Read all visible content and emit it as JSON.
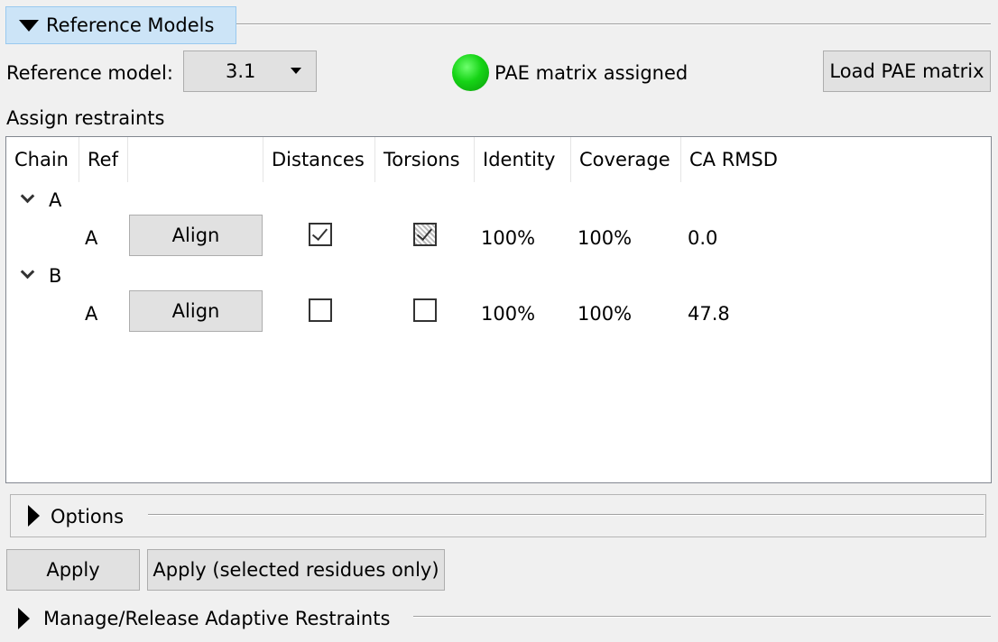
{
  "section": {
    "title": "Reference Models"
  },
  "reference": {
    "label": "Reference model:",
    "selected": "3.1",
    "status_text": "PAE matrix assigned",
    "load_button": "Load PAE matrix"
  },
  "assign_label": "Assign restraints",
  "table": {
    "columns": [
      "Chain",
      "Ref",
      "",
      "Distances",
      "Torsions",
      "Identity",
      "Coverage",
      "CA RMSD"
    ],
    "groups": [
      {
        "chain": "A",
        "rows": [
          {
            "ref": "A",
            "action": "Align",
            "distances": true,
            "torsions": true,
            "identity": "100%",
            "coverage": "100%",
            "rmsd": "0.0"
          }
        ]
      },
      {
        "chain": "B",
        "rows": [
          {
            "ref": "A",
            "action": "Align",
            "distances": false,
            "torsions": false,
            "identity": "100%",
            "coverage": "100%",
            "rmsd": "47.8"
          }
        ]
      }
    ]
  },
  "options": {
    "title": "Options"
  },
  "buttons": {
    "apply": "Apply",
    "apply_selected": "Apply (selected residues only)"
  },
  "manage": {
    "title": "Manage/Release Adaptive Restraints"
  },
  "colors": {
    "status_green": "#16d416",
    "header_bg": "#cce4f7"
  },
  "icons": [
    "collapse-triangle-icon",
    "expand-triangle-icon",
    "dropdown-arrow-icon",
    "chevron-down-icon",
    "checkbox-icon",
    "status-dot-icon"
  ]
}
